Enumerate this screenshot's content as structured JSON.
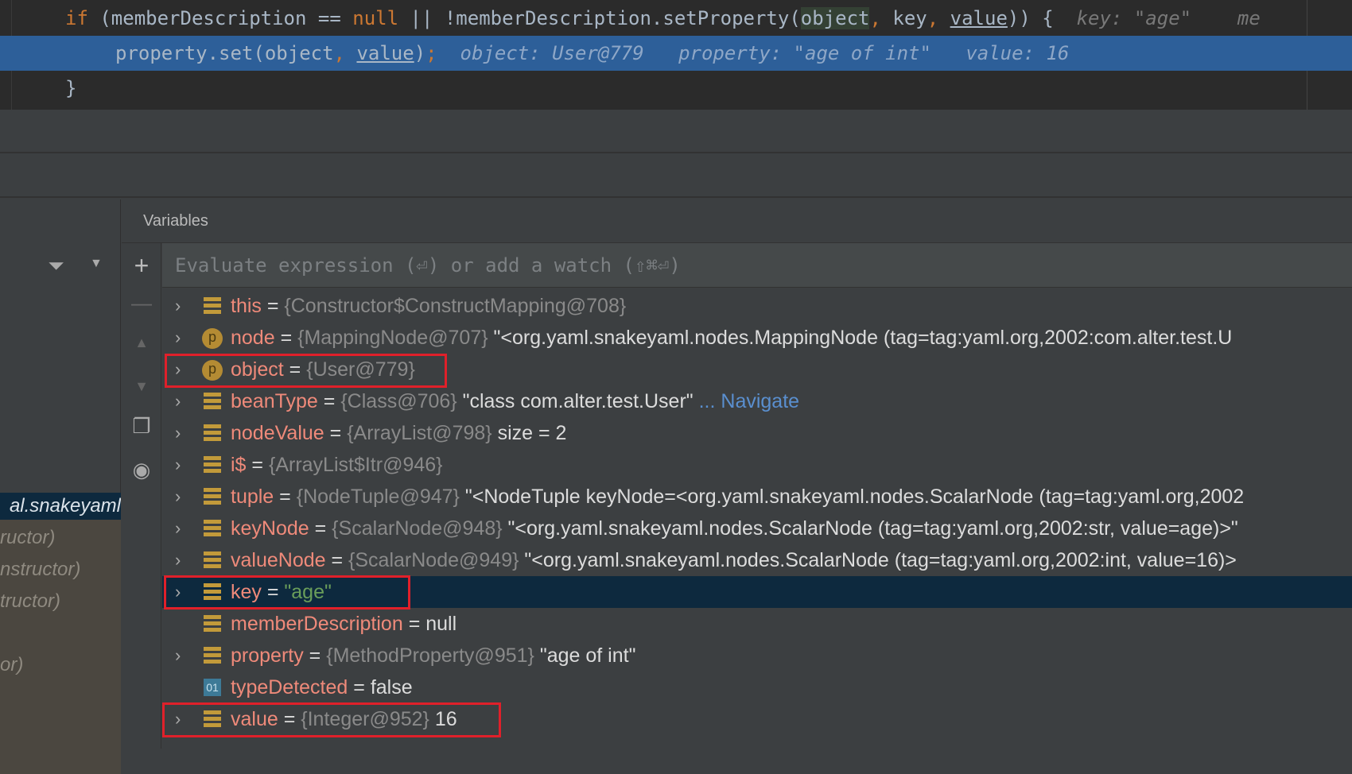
{
  "editor": {
    "lines": [
      {
        "kw1": "if",
        "a": " (memberDescription == ",
        "kw2": "null",
        "b": " || !memberDescription.setProperty(",
        "obj": "object",
        "c1": ",",
        "c": " key",
        "c2": ",",
        "d": " ",
        "val": "value",
        "e": ")) {",
        "hint": "key: \"age\"",
        "hint2": "me"
      },
      {
        "a": "property.set(object",
        "c": ",",
        "d": " ",
        "val": "value",
        "e": ")",
        "semi": ";",
        "h1": "object: User@779",
        "h2": "property: \"age of int\"",
        "h3": "value: 16"
      },
      {
        "a": "}"
      }
    ]
  },
  "variables": {
    "title": "Variables",
    "eval_placeholder": "Evaluate expression (⏎) or add a watch (⇧⌘⏎)",
    "rows": [
      {
        "name": "this",
        "type": "{Constructor$ConstructMapping@708}",
        "value": "",
        "icon": "field",
        "expandable": true
      },
      {
        "name": "node",
        "type": "{MappingNode@707}",
        "value": "\"<org.yaml.snakeyaml.nodes.MappingNode (tag=tag:yaml.org,2002:com.alter.test.U",
        "icon": "parameter",
        "expandable": true
      },
      {
        "name": "object",
        "type": "{User@779}",
        "value": "",
        "icon": "parameter",
        "expandable": true
      },
      {
        "name": "beanType",
        "type": "{Class@706}",
        "value": "\"class com.alter.test.User\"",
        "link": "... Navigate",
        "icon": "field",
        "expandable": true
      },
      {
        "name": "nodeValue",
        "type": "{ArrayList@798}",
        "value": " size = 2",
        "icon": "field",
        "expandable": true
      },
      {
        "name": "i$",
        "type": "{ArrayList$Itr@946}",
        "value": "",
        "icon": "field",
        "expandable": true
      },
      {
        "name": "tuple",
        "type": "{NodeTuple@947}",
        "value": "\"<NodeTuple keyNode=<org.yaml.snakeyaml.nodes.ScalarNode (tag=tag:yaml.org,2002",
        "icon": "field",
        "expandable": true
      },
      {
        "name": "keyNode",
        "type": "{ScalarNode@948}",
        "value": "\"<org.yaml.snakeyaml.nodes.ScalarNode (tag=tag:yaml.org,2002:str, value=age)>\"",
        "icon": "field",
        "expandable": true
      },
      {
        "name": "valueNode",
        "type": "{ScalarNode@949}",
        "value": "\"<org.yaml.snakeyaml.nodes.ScalarNode (tag=tag:yaml.org,2002:int, value=16)>",
        "icon": "field",
        "expandable": true
      },
      {
        "name": "key",
        "type": "",
        "str": "\"age\"",
        "value": "",
        "icon": "field",
        "expandable": true,
        "selected": true
      },
      {
        "name": "memberDescription",
        "type": "",
        "value": "null",
        "icon": "field",
        "expandable": false
      },
      {
        "name": "property",
        "type": "{MethodProperty@951}",
        "value": "\"age of int\"",
        "icon": "field",
        "expandable": true
      },
      {
        "name": "typeDetected",
        "type": "",
        "value": "false",
        "icon": "boolean",
        "icon_text": "01",
        "expandable": false
      },
      {
        "name": "value",
        "type": "{Integer@952}",
        "value": "16",
        "icon": "field",
        "expandable": true
      }
    ]
  },
  "frames": {
    "items": [
      "al.snakeyaml",
      "ructor)",
      "nstructor)",
      "tructor)",
      "",
      "or)"
    ]
  },
  "colors": {
    "highlight_box": "#e0202a",
    "selection": "#0d293e",
    "exec_line": "#2d5f99"
  }
}
